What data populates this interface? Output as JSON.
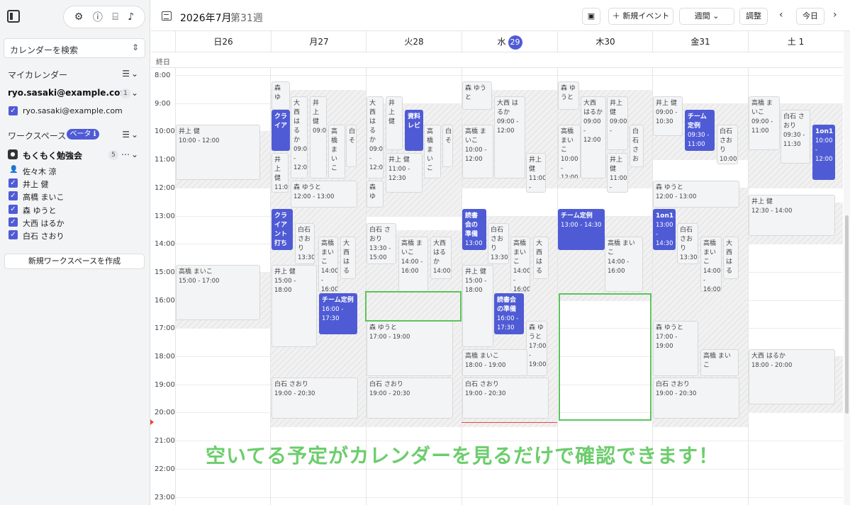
{
  "sidebar": {
    "search_label": "カレンダーを検索",
    "my_calendars_title": "マイカレンダー",
    "account": "ryo.sasaki@example.com",
    "account_count": "1",
    "account_calendar": "ryo.sasaki@example.com",
    "workspace_title": "ワークスペース",
    "beta_label": "ベータ ℹ",
    "workspace_name": "もくもく勉強会",
    "workspace_count": "5",
    "owner": "佐々木 涼",
    "members": [
      "井上 健",
      "高橋 まいこ",
      "森 ゆうと",
      "大西 はるか",
      "白石 さおり"
    ],
    "new_workspace": "新規ワークスペースを作成"
  },
  "header": {
    "title": "2026年7月",
    "week": "第31週",
    "new_event": "＋ 新規イベント",
    "view": "週間",
    "adjust": "調整",
    "today": "今日"
  },
  "days": [
    {
      "dow": "日",
      "num": "26"
    },
    {
      "dow": "月",
      "num": "27"
    },
    {
      "dow": "火",
      "num": "28"
    },
    {
      "dow": "水",
      "num": "29"
    },
    {
      "dow": "木",
      "num": "30"
    },
    {
      "dow": "金",
      "num": "31"
    },
    {
      "dow": "土",
      "num": "1"
    }
  ],
  "allday_label": "終日",
  "hours": [
    "8:00",
    "9:00",
    "10:00",
    "11:00",
    "12:00",
    "13:00",
    "14:00",
    "15:00",
    "16:00",
    "17:00",
    "18:00",
    "19:00",
    "20:00",
    "21:00",
    "22:00",
    "23:00"
  ],
  "events": [
    {
      "title": "井上 健",
      "time": "10:00 - 12:00"
    },
    {
      "title": "高橋 まいこ",
      "time": "15:00 - 17:00"
    },
    {
      "title": "森 ゆ",
      "time": ""
    },
    {
      "title": "クライア",
      "time": ""
    },
    {
      "title": "大西 はるか",
      "time": "09:0 - 12:0"
    },
    {
      "title": "井上 健",
      "time": "09:0"
    },
    {
      "title": "高橋 まいこ",
      "time": ""
    },
    {
      "title": "白 そ",
      "time": ""
    },
    {
      "title": "井上 健",
      "time": "11:0"
    },
    {
      "title": "森 ゆうと",
      "time": "12:00 - 13:00"
    },
    {
      "title": "クライアント打ち",
      "time": ""
    },
    {
      "title": "白石 さおり",
      "time": "13:30"
    },
    {
      "title": "高橋 まいこ",
      "time": "14:00 - 16:00"
    },
    {
      "title": "大西 はる",
      "time": ""
    },
    {
      "title": "井上 健",
      "time": "15:00 - 18:00"
    },
    {
      "title": "チーム定例",
      "time": "16:00 - 17:30"
    },
    {
      "title": "白石 さおり",
      "time": "19:00 - 20:30"
    },
    {
      "title": "大西 はるか",
      "time": "09:0 - 12:0"
    },
    {
      "title": "井上 健",
      "time": ""
    },
    {
      "title": "資料レビ",
      "time": ""
    },
    {
      "title": "高橋 まいこ",
      "time": ""
    },
    {
      "title": "白 そ",
      "time": ""
    },
    {
      "title": "井上 健",
      "time": "11:00 - 12:30"
    },
    {
      "title": "森 ゆ",
      "time": ""
    },
    {
      "title": "白石 さおり",
      "time": "13:30 - 15:00"
    },
    {
      "title": "高橋 まいこ",
      "time": "14:00 - 16:00"
    },
    {
      "title": "大西 はるか",
      "time": "14:00"
    },
    {
      "title": "森 ゆうと",
      "time": "17:00 - 19:00"
    },
    {
      "title": "白石 さおり",
      "time": "19:00 - 20:30"
    },
    {
      "title": "森 ゆうと",
      "time": ""
    },
    {
      "title": "大西 はるか",
      "time": "09:00 - 12:00"
    },
    {
      "title": "高橋 まいこ",
      "time": "10:00 - 12:00"
    },
    {
      "title": "井上 健",
      "time": "11:00 -"
    },
    {
      "title": "読書会の準備",
      "time": "13:00"
    },
    {
      "title": "白石 さおり",
      "time": "13:30"
    },
    {
      "title": "高橋 まいこ",
      "time": "14:00 - 16:00"
    },
    {
      "title": "大西 はる",
      "time": ""
    },
    {
      "title": "井上 健",
      "time": "15:00 - 18:00"
    },
    {
      "title": "読書会の準備",
      "time": "16:00 - 17:30"
    },
    {
      "title": "森 ゆうと",
      "time": "17:00 - 19:00"
    },
    {
      "title": "高橋 まいこ",
      "time": "18:00 - 19:00"
    },
    {
      "title": "白石 さおり",
      "time": "19:00 - 20:30"
    },
    {
      "title": "森 ゆうと",
      "time": ""
    },
    {
      "title": "大西 はるか",
      "time": "09:00 - 12:00"
    },
    {
      "title": "井上 健",
      "time": "09:00 -"
    },
    {
      "title": "高橋 まいこ",
      "time": "10:00 - 12:00"
    },
    {
      "title": "白石 さお",
      "time": ""
    },
    {
      "title": "井上 健",
      "time": "11:00 -"
    },
    {
      "title": "チーム定例",
      "time": "13:00 - 14:30"
    },
    {
      "title": "高橋 まいこ",
      "time": "14:00 - 16:00"
    },
    {
      "title": "井上 健",
      "time": "09:00 - 10:30"
    },
    {
      "title": "チーム定例",
      "time": "09:30 - 11:00"
    },
    {
      "title": "白石 さおり",
      "time": "10:00"
    },
    {
      "title": "森 ゆうと",
      "time": "12:00 - 13:00"
    },
    {
      "title": "1on1",
      "time": "13:00 - 14:30"
    },
    {
      "title": "白石 さおり",
      "time": "13:30"
    },
    {
      "title": "高橋 まいこ",
      "time": "14:00 - 16:00"
    },
    {
      "title": "大西 はる",
      "time": ""
    },
    {
      "title": "森 ゆうと",
      "time": "17:00 - 19:00"
    },
    {
      "title": "高橋 まいこ",
      "time": ""
    },
    {
      "title": "白石 さおり",
      "time": "19:00 - 20:30"
    },
    {
      "title": "高橋 まいこ",
      "time": "09:00 - 11:00"
    },
    {
      "title": "白石 さおり",
      "time": "09:30 - 11:30"
    },
    {
      "title": "1on1",
      "time": "10:00 - 12:00"
    },
    {
      "title": "井上 健",
      "time": "12:30 - 14:00"
    },
    {
      "title": "大西 はるか",
      "time": "18:00 - 20:00"
    }
  ],
  "caption": "空いてる予定がカレンダーを見るだけで確認できます！",
  "colors": {
    "accent": "#4f5bd5",
    "highlight": "#5cc35c",
    "caption": "#6ccd6c"
  }
}
